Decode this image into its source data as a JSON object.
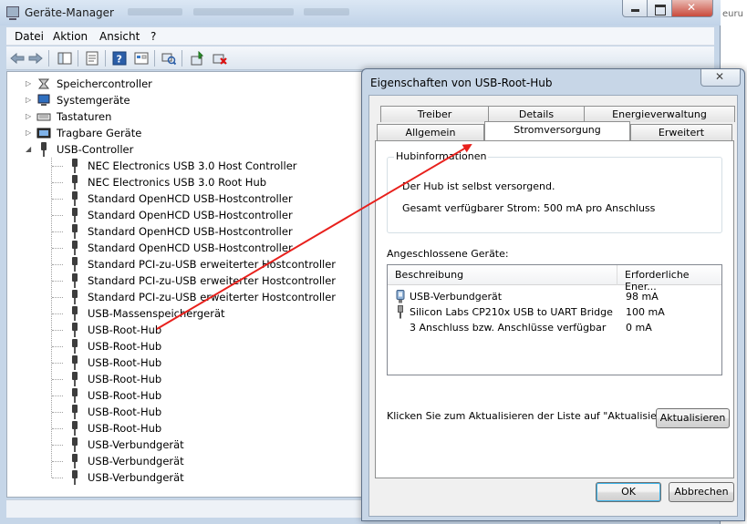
{
  "device_manager": {
    "title": "Geräte-Manager",
    "menu": [
      "Datei",
      "Aktion",
      "Ansicht",
      "?"
    ],
    "tree": [
      {
        "label": "Speichercontroller",
        "kind": "category",
        "state": "collapsed",
        "icon": "storage-controller-icon"
      },
      {
        "label": "Systemgeräte",
        "kind": "category",
        "state": "collapsed",
        "icon": "system-devices-icon"
      },
      {
        "label": "Tastaturen",
        "kind": "category",
        "state": "collapsed",
        "icon": "keyboard-icon"
      },
      {
        "label": "Tragbare Geräte",
        "kind": "category",
        "state": "collapsed",
        "icon": "portable-device-icon"
      },
      {
        "label": "USB-Controller",
        "kind": "category",
        "state": "expanded",
        "icon": "usb-icon"
      },
      {
        "label": "NEC Electronics USB 3.0 Host Controller",
        "kind": "device"
      },
      {
        "label": "NEC Electronics USB 3.0 Root Hub",
        "kind": "device"
      },
      {
        "label": "Standard OpenHCD USB-Hostcontroller",
        "kind": "device"
      },
      {
        "label": "Standard OpenHCD USB-Hostcontroller",
        "kind": "device"
      },
      {
        "label": "Standard OpenHCD USB-Hostcontroller",
        "kind": "device"
      },
      {
        "label": "Standard OpenHCD USB-Hostcontroller",
        "kind": "device"
      },
      {
        "label": "Standard PCI-zu-USB erweiterter Hostcontroller",
        "kind": "device"
      },
      {
        "label": "Standard PCI-zu-USB erweiterter Hostcontroller",
        "kind": "device"
      },
      {
        "label": "Standard PCI-zu-USB erweiterter Hostcontroller",
        "kind": "device"
      },
      {
        "label": "USB-Massenspeichergerät",
        "kind": "device"
      },
      {
        "label": "USB-Root-Hub",
        "kind": "device"
      },
      {
        "label": "USB-Root-Hub",
        "kind": "device"
      },
      {
        "label": "USB-Root-Hub",
        "kind": "device"
      },
      {
        "label": "USB-Root-Hub",
        "kind": "device"
      },
      {
        "label": "USB-Root-Hub",
        "kind": "device"
      },
      {
        "label": "USB-Root-Hub",
        "kind": "device"
      },
      {
        "label": "USB-Root-Hub",
        "kind": "device"
      },
      {
        "label": "USB-Verbundgerät",
        "kind": "device"
      },
      {
        "label": "USB-Verbundgerät",
        "kind": "device"
      },
      {
        "label": "USB-Verbundgerät",
        "kind": "device"
      }
    ],
    "edge_text": "euru"
  },
  "dialog": {
    "title": "Eigenschaften von USB-Root-Hub",
    "tabs_back": [
      "Treiber",
      "Details",
      "Energieverwaltung"
    ],
    "tabs_front": [
      "Allgemein",
      "Stromversorgung",
      "Erweitert"
    ],
    "active_tab": "Stromversorgung",
    "hub_group_title": "Hubinformationen",
    "hub_self_powered": "Der Hub ist selbst versorgend.",
    "hub_power_available": "Gesamt verfügbarer Strom: 500 mA pro Anschluss",
    "connected_label": "Angeschlossene Geräte:",
    "columns": [
      "Beschreibung",
      "Erforderliche Ener..."
    ],
    "devices": [
      {
        "name": "USB-Verbundgerät",
        "value": "98 mA",
        "icon": "composite-device-icon"
      },
      {
        "name": "Silicon Labs CP210x USB to UART Bridge",
        "value": "100 mA",
        "icon": "usb-plug-icon"
      },
      {
        "name": "3 Anschluss bzw. Anschlüsse verfügbar",
        "value": "0 mA",
        "icon": ""
      }
    ],
    "refresh_hint": "Klicken Sie zum Aktualisieren der Liste auf \"Aktualisieren\".",
    "refresh_button": "Aktualisieren",
    "ok_button": "OK",
    "cancel_button": "Abbrechen"
  },
  "annotation": {
    "arrow_color": "#e8201c"
  }
}
